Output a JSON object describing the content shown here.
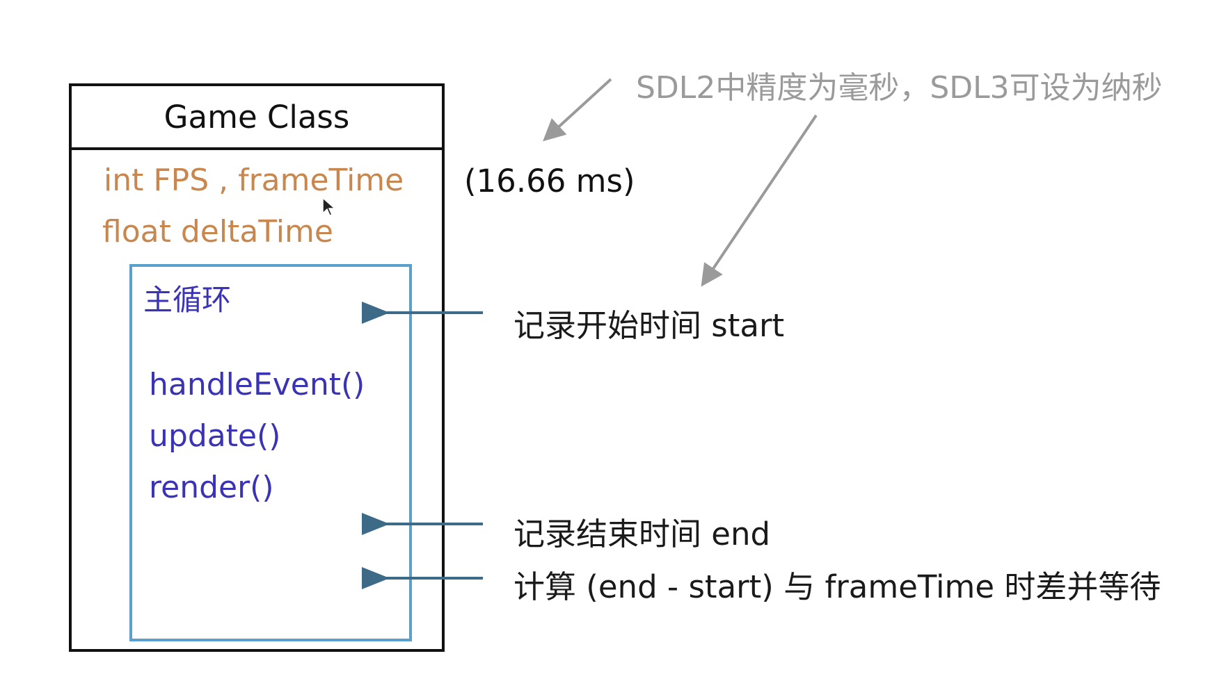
{
  "class_box": {
    "title": "Game Class",
    "fields": [
      "int FPS , frameTime",
      "float deltaTime"
    ]
  },
  "main_loop": {
    "title": "主循环",
    "methods": [
      "handleEvent()",
      "update()",
      "render()"
    ]
  },
  "frame_time_note": "(16.66 ms)",
  "precision_note": "SDL2中精度为毫秒，SDL3可设为纳秒",
  "annotations": {
    "start": "记录开始时间 start",
    "end": "记录结束时间 end",
    "wait": "计算 (end - start) 与 frameTime 时差并等待"
  },
  "colors": {
    "field_text": "#c8874e",
    "loop_text": "#3a33b6",
    "loop_border": "#5aa0cd",
    "arrow_dark": "#3d6a87",
    "arrow_grey": "#9a9a9a",
    "note_text": "#9a9a9a"
  }
}
